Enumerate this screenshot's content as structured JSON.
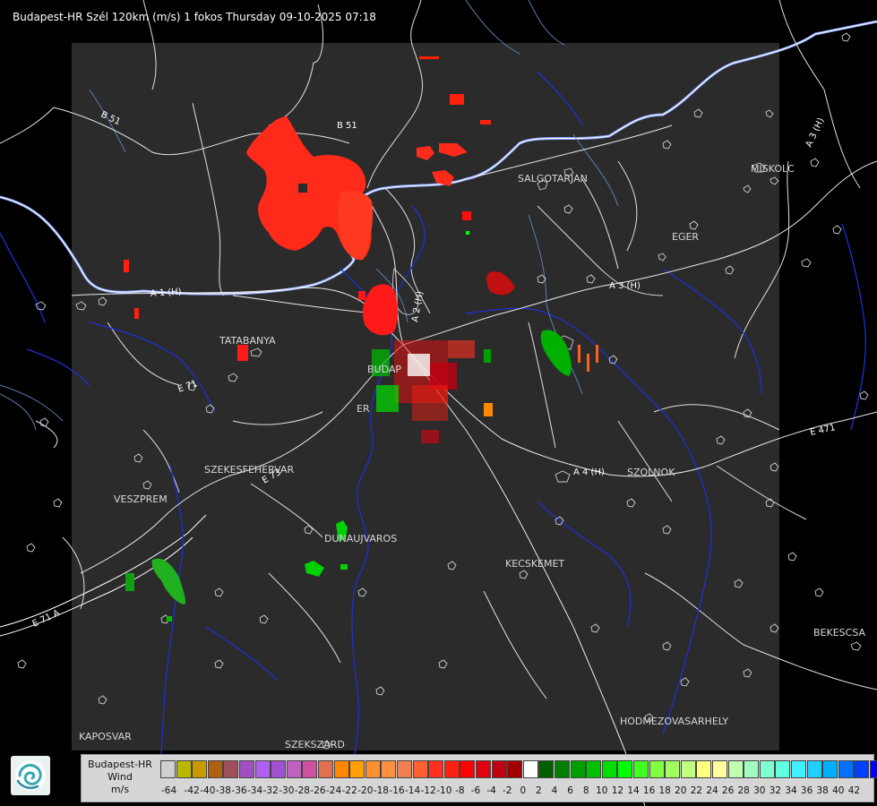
{
  "title": "Budapest-HR Szél 120km (m/s) 1 fokos Thursday 09-10-2025 07:18",
  "cities": [
    {
      "id": "salgotarjan",
      "name": "SALGOTARJAN"
    },
    {
      "id": "miskolc",
      "name": "MISKOLC"
    },
    {
      "id": "eger",
      "name": "EGER"
    },
    {
      "id": "tatabanya",
      "name": "TATABANYA"
    },
    {
      "id": "budapest",
      "name": "BUDAP"
    },
    {
      "id": "erd",
      "name": "ER"
    },
    {
      "id": "szekesfehervar",
      "name": "SZEKESFEHERVAR"
    },
    {
      "id": "veszprem",
      "name": "VESZPREM"
    },
    {
      "id": "dunaujvaros",
      "name": "DUNAUJVAROS"
    },
    {
      "id": "kecskemet",
      "name": "KECSKEMET"
    },
    {
      "id": "szolnok",
      "name": "SZOLNOK"
    },
    {
      "id": "bekescsaba",
      "name": "BEKESCSA"
    },
    {
      "id": "hodmezovasarhely",
      "name": "HODMEZOVASARHELY"
    },
    {
      "id": "kaposvar",
      "name": "KAPOSVAR"
    },
    {
      "id": "szekszard",
      "name": "SZEKSZARD"
    }
  ],
  "roads": [
    {
      "id": "b51-west",
      "name": "B 51"
    },
    {
      "id": "b51-east",
      "name": "B 51"
    },
    {
      "id": "a3",
      "name": "A 3 (H)"
    },
    {
      "id": "a3-ne",
      "name": "A 3 (H)"
    },
    {
      "id": "a4",
      "name": "A 4 (H)"
    },
    {
      "id": "a1",
      "name": "A 1 (H)"
    },
    {
      "id": "a2",
      "name": "A 2 (H)"
    },
    {
      "id": "e71",
      "name": "E 71"
    },
    {
      "id": "e73",
      "name": "E 73"
    },
    {
      "id": "e71-sw",
      "name": "E 71 A"
    },
    {
      "id": "e471",
      "name": "E 471"
    }
  ],
  "legend": {
    "station": "Budapest-HR",
    "quantity": "Wind",
    "unit": "m/s",
    "colors": [
      "#d0d0d0",
      "#b8b800",
      "#c89a00",
      "#b06010",
      "#a0505a",
      "#a050c0",
      "#b060f0",
      "#a050d0",
      "#c060c0",
      "#d050a0",
      "#e07050",
      "#ff8800",
      "#ffa000",
      "#ff9030",
      "#ff9040",
      "#f08050",
      "#ff6030",
      "#ff3020",
      "#ff2010",
      "#ff0000",
      "#e00010",
      "#c00010",
      "#a00000",
      "#ffffff",
      "#006000",
      "#008000",
      "#00a000",
      "#00c000",
      "#00e000",
      "#00ff00",
      "#40ff20",
      "#80ff40",
      "#a0ff60",
      "#c0ff80",
      "#ffff80",
      "#ffffa0",
      "#c0ffb0",
      "#a0ffc0",
      "#80ffd0",
      "#60ffe0",
      "#40f0ff",
      "#20d0ff",
      "#00b0ff",
      "#0070ff",
      "#0040ff",
      "#0000ff"
    ],
    "ticks": [
      "-64",
      "-42",
      "-40",
      "-38",
      "-36",
      "-34",
      "-32",
      "-30",
      "-28",
      "-26",
      "-24",
      "-22",
      "-20",
      "-18",
      "-16",
      "-14",
      "-12",
      "-10",
      "-8",
      "-6",
      "-4",
      "-2",
      "0",
      "2",
      "4",
      "6",
      "8",
      "10",
      "12",
      "14",
      "16",
      "18",
      "20",
      "22",
      "24",
      "26",
      "28",
      "30",
      "32",
      "34",
      "36",
      "38",
      "40",
      "42"
    ]
  }
}
